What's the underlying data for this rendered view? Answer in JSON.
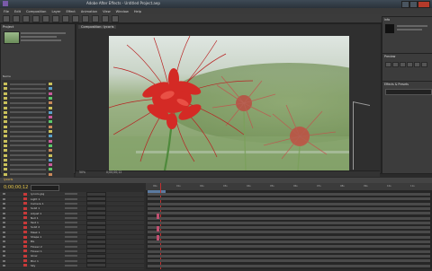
{
  "window": {
    "title": "Adobe After Effects - Untitled Project.aep"
  },
  "menu": [
    "File",
    "Edit",
    "Composition",
    "Layer",
    "Effect",
    "Animation",
    "View",
    "Window",
    "Help"
  ],
  "project": {
    "tab": "Project",
    "list_header": "Name"
  },
  "comp": {
    "tab": "Composition: lycoris",
    "zoom": "50%",
    "timecode": "0;00;00;12"
  },
  "right": {
    "info_tab": "Info",
    "preview_tab": "Preview",
    "effects_tab": "Effects & Presets"
  },
  "timeline": {
    "tab": "lycoris",
    "timecode": "0;00;00;12"
  },
  "layers": [
    "lycoris.jpg",
    "Light 1",
    "Camera 1",
    "Solid 1",
    "Adjust 1",
    "Null 1",
    "Text 1",
    "Solid 2",
    "Mask 1",
    "Shape 1",
    "BG",
    "Flower 2",
    "Flower 1",
    "Glow",
    "Blur 1",
    "Sky"
  ],
  "ruler_ticks": [
    "00s",
    "01s",
    "02s",
    "03s",
    "04s",
    "05s",
    "06s",
    "07s",
    "08s",
    "09s",
    "10s",
    "11s"
  ],
  "colors": {
    "accent": "#e8c84a",
    "playhead": "#c03030",
    "label_red": "#c73a3a"
  }
}
